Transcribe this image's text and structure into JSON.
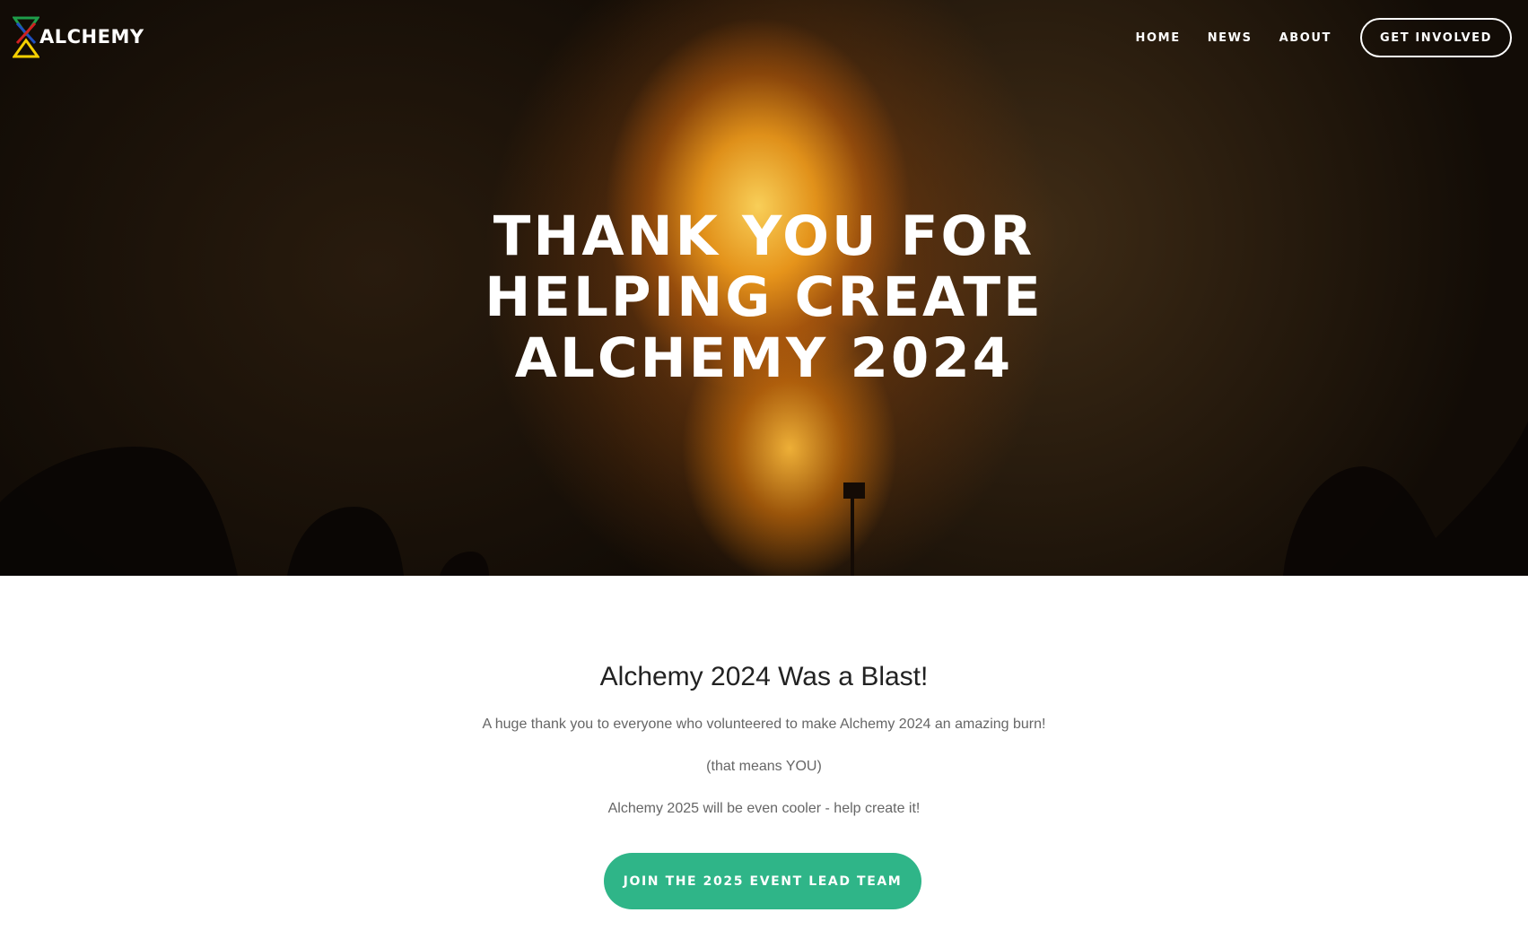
{
  "brand": {
    "name": "ALCHEMY",
    "logo_colors": [
      "#1e9e4a",
      "#1f4fbf",
      "#d02020",
      "#f5d000"
    ]
  },
  "nav": {
    "items": [
      {
        "label": "HOME"
      },
      {
        "label": "NEWS"
      },
      {
        "label": "ABOUT"
      }
    ],
    "cta_label": "GET INVOLVED"
  },
  "hero": {
    "title_lines": [
      "THANK YOU FOR",
      "HELPING CREATE",
      "ALCHEMY 2024"
    ]
  },
  "content": {
    "heading": "Alchemy 2024 Was a Blast!",
    "paragraphs": [
      "A huge thank you to everyone who volunteered to make Alchemy 2024 an amazing burn!",
      "(that means YOU)",
      "Alchemy 2025 will be even cooler - help create it!"
    ],
    "button_label": "JOIN THE 2025 EVENT LEAD TEAM",
    "button_color": "#2fb588"
  }
}
